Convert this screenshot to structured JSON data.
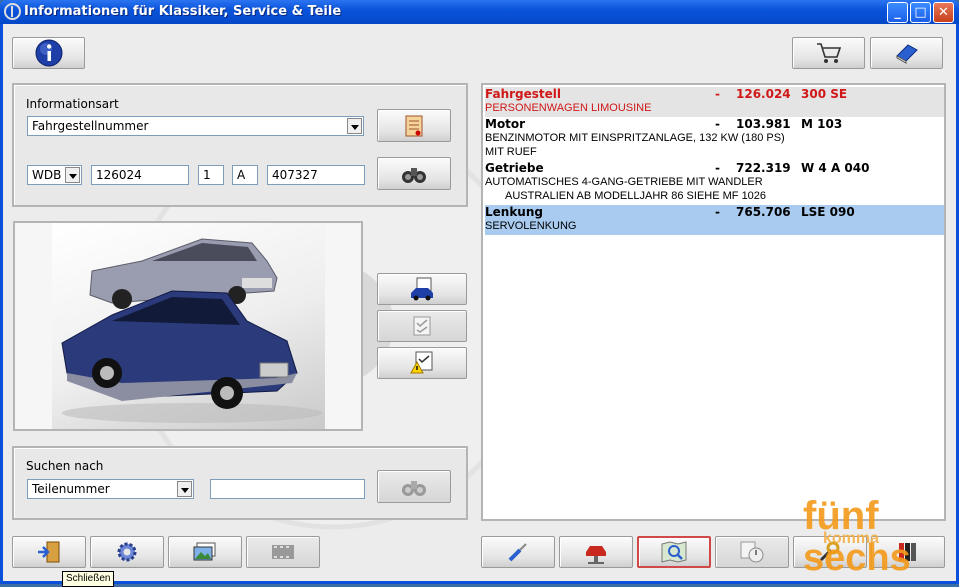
{
  "window": {
    "title": "Informationen für Klassiker, Service & Teile",
    "controls": [
      "minimize-icon",
      "maximize-icon",
      "close-icon"
    ]
  },
  "top_toolbar": {
    "info_icon": "info-icon",
    "cart_icon": "cart-icon",
    "book_icon": "book-icon"
  },
  "info_panel": {
    "label": "Informationsart",
    "type_select": "Fahrgestellnummer",
    "prefix_select": "WDB",
    "field_1": "126024",
    "field_2": "1",
    "field_3": "A",
    "field_4": "407327"
  },
  "search_panel": {
    "label": "Suchen nach",
    "select": "Teilenummer",
    "input_value": ""
  },
  "results": [
    {
      "name": "Fahrgestell",
      "dash": "-",
      "number": "126.024",
      "code": "300 SE",
      "desc": [
        "PERSONENWAGEN LIMOUSINE"
      ],
      "color": "#d01818",
      "bg": "#e4e4e4"
    },
    {
      "name": "Motor",
      "dash": "-",
      "number": "103.981",
      "code": "M 103",
      "desc": [
        "BENZINMOTOR MIT EINSPRITZANLAGE, 132 KW (180 PS)",
        "MIT RUEF"
      ],
      "color": "#000000",
      "bg": "#ffffff"
    },
    {
      "name": "Getriebe",
      "dash": "-",
      "number": "722.319",
      "code": "W 4 A 040",
      "desc": [
        "AUTOMATISCHES 4-GANG-GETRIEBE MIT WANDLER",
        "     AUSTRALIEN AB MODELLJAHR 86 SIEHE MF 1026"
      ],
      "color": "#000000",
      "bg": "#ffffff"
    },
    {
      "name": "Lenkung",
      "dash": "-",
      "number": "765.706",
      "code": "LSE 090",
      "desc": [
        "SERVOLENKUNG"
      ],
      "color": "#000000",
      "bg": "#a9cbf0"
    }
  ],
  "tooltip": "Schließen",
  "watermark": {
    "line1": "fünf",
    "line2": "komma",
    "line3": "sechs"
  },
  "colors": {
    "title_bar": "#0a54dc",
    "highlight": "#a9cbf0",
    "red_text": "#d01818",
    "logo": "#f49a1a"
  }
}
